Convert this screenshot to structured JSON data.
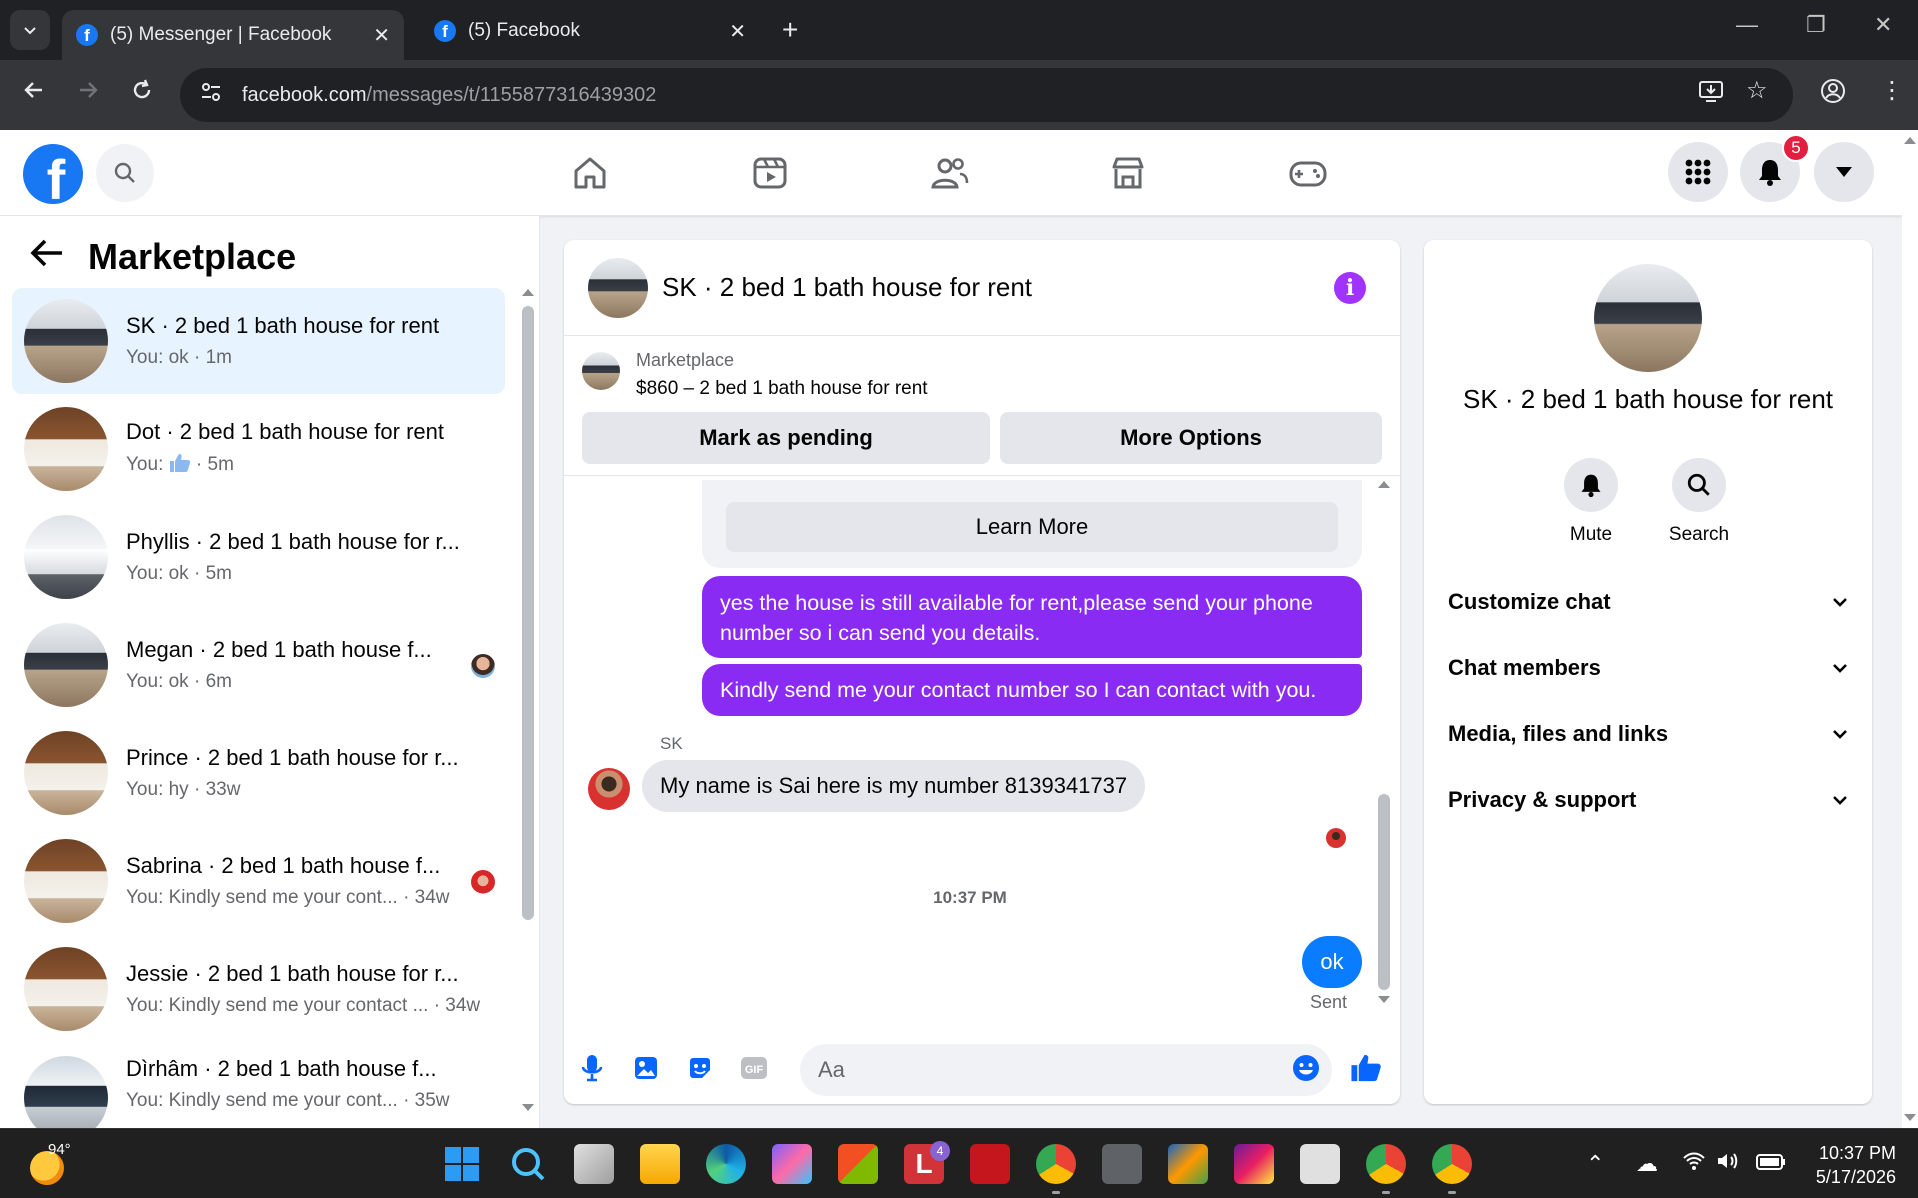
{
  "browser": {
    "tabs": [
      {
        "title": "(5) Messenger | Facebook",
        "active": true
      },
      {
        "title": "(5) Facebook",
        "active": false
      }
    ],
    "url_host": "facebook.com",
    "url_path": "/messages/t/1155877316439302"
  },
  "header": {
    "notification_count": "5"
  },
  "sidebar": {
    "title": "Marketplace",
    "conversations": [
      {
        "name": "SK · 2 bed 1 bath house for rent",
        "preview": "You: ok · 1m",
        "active": true
      },
      {
        "name": "Dot · 2 bed 1 bath house for rent",
        "preview_prefix": "You:",
        "preview_suffix": "· 5m",
        "active": false
      },
      {
        "name": "Phyllis · 2 bed 1 bath house for r...",
        "preview": "You: ok · 5m",
        "active": false
      },
      {
        "name": "Megan · 2 bed 1 bath house f...",
        "preview": "You: ok · 6m",
        "active": false
      },
      {
        "name": "Prince · 2 bed 1 bath house for r...",
        "preview": "You: hy · 33w",
        "active": false
      },
      {
        "name": "Sabrina · 2 bed 1 bath house f...",
        "preview": "You: Kindly send me your cont... · 34w",
        "active": false
      },
      {
        "name": "Jessie · 2 bed 1 bath house for r...",
        "preview": "You: Kindly send me your contact ... · 34w",
        "active": false
      },
      {
        "name": "Dìrhâm · 2 bed 1 bath house f...",
        "preview": "You: Kindly send me your cont... · 35w",
        "active": false
      }
    ]
  },
  "chat": {
    "title": "SK · 2 bed 1 bath house for rent",
    "marketplace_label": "Marketplace",
    "listing": "$860 – 2 bed 1 bath house for rent",
    "mark_pending_label": "Mark as pending",
    "more_options_label": "More Options",
    "learn_more_label": "Learn More",
    "messages": [
      {
        "from": "me",
        "text": "yes the house is still available for rent,please send your phone number so i can send you details."
      },
      {
        "from": "me",
        "text": "Kindly send me your contact number so I can contact with you."
      },
      {
        "from": "SK",
        "sender_label": "SK",
        "text": "My name is Sai here is my number 8139341737"
      },
      {
        "from": "me",
        "text": "ok",
        "status": "Sent"
      }
    ],
    "timestamp": "10:37 PM",
    "composer_placeholder": "Aa"
  },
  "details": {
    "name": "SK · 2 bed 1 bath house for rent",
    "mute_label": "Mute",
    "search_label": "Search",
    "sections": [
      "Customize chat",
      "Chat members",
      "Media, files and links",
      "Privacy & support"
    ]
  },
  "taskbar": {
    "weather": "94°",
    "time": "10:37 PM",
    "date": "5/17/2026",
    "badges": {
      "office_l": "4"
    }
  },
  "colors": {
    "accent_blue": "#1877f2",
    "outgoing_bubble": "#8a2bf3",
    "ok_bubble": "#0a7cff",
    "active_conv": "#e7f3ff",
    "badge_red": "#e41e3f"
  }
}
